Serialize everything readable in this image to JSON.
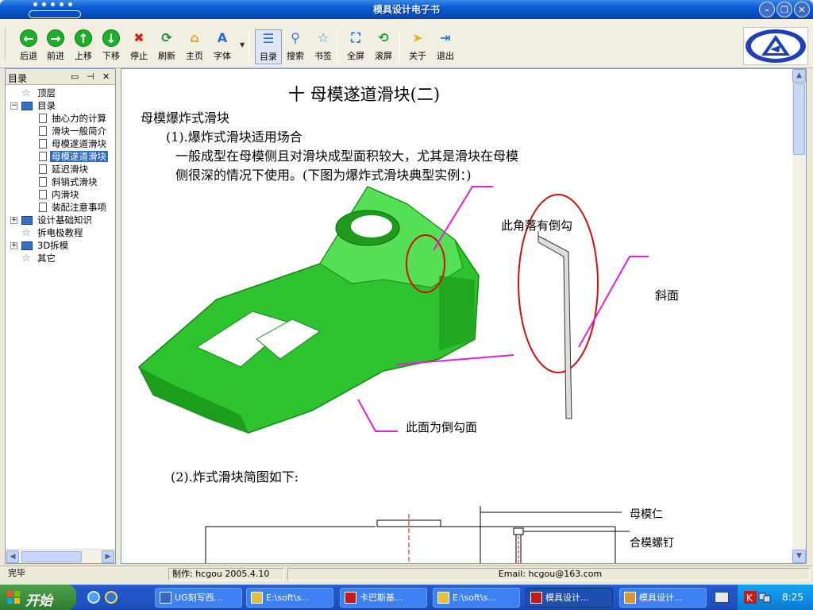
{
  "window": {
    "title": "模具设计电子书"
  },
  "toolbar": {
    "items": [
      {
        "label": "后退",
        "icon": "back-arrow-icon"
      },
      {
        "label": "前进",
        "icon": "forward-arrow-icon"
      },
      {
        "label": "上移",
        "icon": "up-arrow-icon"
      },
      {
        "label": "下移",
        "icon": "down-arrow-icon"
      },
      {
        "label": "停止",
        "icon": "stop-icon"
      },
      {
        "label": "刷新",
        "icon": "refresh-icon"
      },
      {
        "label": "主页",
        "icon": "home-icon"
      },
      {
        "label": "字体",
        "icon": "font-icon"
      },
      {
        "label": "目录",
        "icon": "toc-icon"
      },
      {
        "label": "搜索",
        "icon": "search-icon"
      },
      {
        "label": "书签",
        "icon": "bookmark-icon"
      },
      {
        "label": "全屏",
        "icon": "fullscreen-icon"
      },
      {
        "label": "滚屏",
        "icon": "autoscroll-icon"
      },
      {
        "label": "关于",
        "icon": "about-icon"
      },
      {
        "label": "退出",
        "icon": "exit-icon"
      }
    ]
  },
  "sidebar": {
    "title": "目录",
    "tree": [
      {
        "label": "顶层",
        "level": 0
      },
      {
        "label": "目录",
        "level": 0,
        "expanded": true
      },
      {
        "label": "抽心力的计算",
        "level": 1
      },
      {
        "label": "滑块一般简介",
        "level": 1
      },
      {
        "label": "母模遂道滑块",
        "level": 1
      },
      {
        "label": "母模遂道滑块",
        "level": 1,
        "selected": true
      },
      {
        "label": "延迟滑块",
        "level": 1
      },
      {
        "label": "斜销式滑块",
        "level": 1
      },
      {
        "label": "内滑块",
        "level": 1
      },
      {
        "label": "装配注意事项",
        "level": 1
      },
      {
        "label": "设计基础知识",
        "level": 0,
        "expandable": true
      },
      {
        "label": "拆电极教程",
        "level": 0
      },
      {
        "label": "3D拆模",
        "level": 0,
        "expandable": true
      },
      {
        "label": "其它",
        "level": 0
      }
    ]
  },
  "document": {
    "title": "十 母模遂道滑块(二)",
    "subtitle": "母模爆炸式滑块",
    "item1": "(1).爆炸式滑块适用场合",
    "para1": "一般成型在母模侧且对滑块成型面积较大，尤其是滑块在母模",
    "para2": "侧很深的情况下使用。(下图为爆炸式滑块典型实例：)",
    "callout1": "此角落有倒勾",
    "callout2": "斜面",
    "callout3": "此面为倒勾面",
    "item2": "(2).炸式滑块简图如下:",
    "label_a": "母模仁",
    "label_b": "合模螺钉"
  },
  "status": {
    "state": "完毕",
    "author": "制作: hcgou  2005.4.10",
    "email": "Email: hcgou@163.com"
  },
  "taskbar": {
    "start": "开始",
    "tasks": [
      {
        "label": "UG刻写西...",
        "active": false
      },
      {
        "label": "E:\\soft\\s...",
        "active": false
      },
      {
        "label": "卡巴斯基...",
        "active": false
      },
      {
        "label": "E:\\soft\\s...",
        "active": false
      },
      {
        "label": "模具设计...",
        "active": true
      },
      {
        "label": "模具设计...",
        "active": false
      }
    ],
    "clock": "8:25"
  }
}
